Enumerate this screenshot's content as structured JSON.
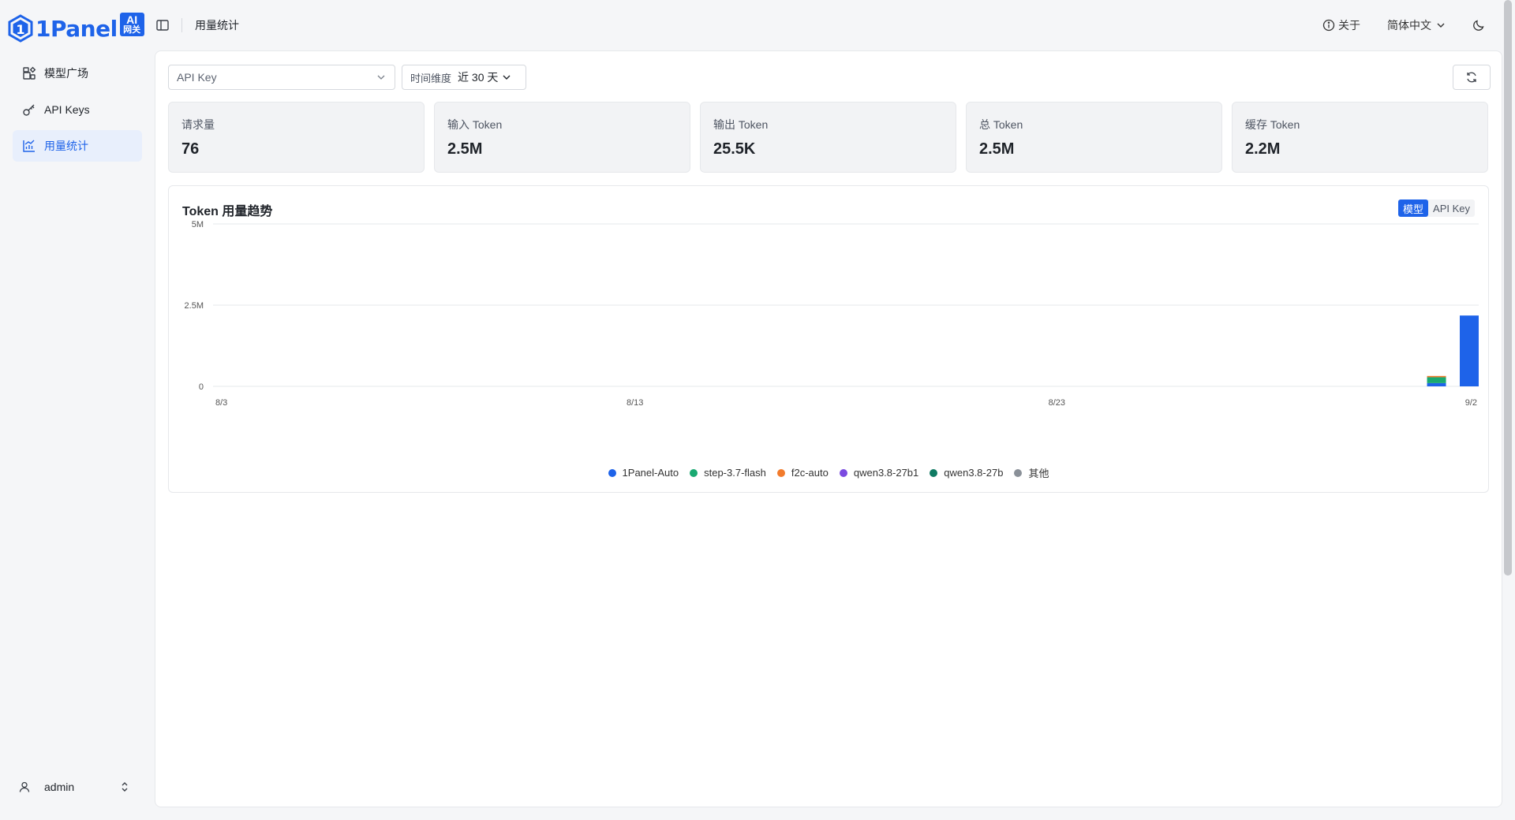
{
  "brand": {
    "name": "1Panel",
    "badge_top": "AI",
    "badge_bottom": "网关",
    "color": "#1e63e9"
  },
  "sidebar": {
    "items": [
      {
        "label": "模型广场",
        "icon": "grid-icon",
        "active": false
      },
      {
        "label": "API Keys",
        "icon": "key-icon",
        "active": false
      },
      {
        "label": "用量统计",
        "icon": "chart-icon",
        "active": true
      }
    ],
    "user": {
      "name": "admin"
    }
  },
  "topbar": {
    "breadcrumb": "用量统计",
    "about": "关于",
    "language": "简体中文"
  },
  "filters": {
    "apikey_placeholder": "API Key",
    "range_label": "时间维度",
    "range_value": "近 30 天"
  },
  "stats": [
    {
      "title": "请求量",
      "value": "76"
    },
    {
      "title": "输入 Token",
      "value": "2.5M"
    },
    {
      "title": "输出 Token",
      "value": "25.5K"
    },
    {
      "title": "总 Token",
      "value": "2.5M"
    },
    {
      "title": "缓存 Token",
      "value": "2.2M"
    }
  ],
  "chart": {
    "title": "Token 用量趋势",
    "toggle": {
      "model": "模型",
      "apikey": "API Key",
      "active": "model"
    }
  },
  "chart_data": {
    "type": "bar",
    "stacked": true,
    "title": "Token 用量趋势",
    "xlabel": "",
    "ylabel": "",
    "x_start": "8/3",
    "x_end": "9/2",
    "x_ticks": [
      "8/3",
      "8/13",
      "8/23",
      "9/2"
    ],
    "y_ticks": [
      "0",
      "2.5M",
      "5M"
    ],
    "ylim": [
      0,
      5000000
    ],
    "grid": true,
    "legend_placement": "bottom",
    "categories": [
      "8/3",
      "8/4",
      "8/5",
      "8/6",
      "8/7",
      "8/8",
      "8/9",
      "8/10",
      "8/11",
      "8/12",
      "8/13",
      "8/14",
      "8/15",
      "8/16",
      "8/17",
      "8/18",
      "8/19",
      "8/20",
      "8/21",
      "8/22",
      "8/23",
      "8/24",
      "8/25",
      "8/26",
      "8/27",
      "8/28",
      "8/29",
      "8/30",
      "8/31",
      "9/1",
      "9/2"
    ],
    "series": [
      {
        "name": "1Panel-Auto",
        "color": "#1e63e9",
        "values": [
          0,
          0,
          0,
          0,
          0,
          0,
          0,
          0,
          0,
          0,
          0,
          0,
          0,
          0,
          0,
          0,
          0,
          0,
          0,
          0,
          0,
          0,
          0,
          0,
          0,
          0,
          0,
          0,
          0,
          100000,
          2180000
        ]
      },
      {
        "name": "step-3.7-flash",
        "color": "#19a971",
        "values": [
          0,
          0,
          0,
          0,
          0,
          0,
          0,
          0,
          0,
          0,
          0,
          0,
          0,
          0,
          0,
          0,
          0,
          0,
          0,
          0,
          0,
          0,
          0,
          0,
          0,
          0,
          0,
          0,
          0,
          180000,
          0
        ]
      },
      {
        "name": "f2c-auto",
        "color": "#f27b2c",
        "values": [
          0,
          0,
          0,
          0,
          0,
          0,
          0,
          0,
          0,
          0,
          0,
          0,
          0,
          0,
          0,
          0,
          0,
          0,
          0,
          0,
          0,
          0,
          0,
          0,
          0,
          0,
          0,
          0,
          0,
          40000,
          0
        ]
      },
      {
        "name": "qwen3.8-27b1",
        "color": "#7a4ae0",
        "values": [
          0,
          0,
          0,
          0,
          0,
          0,
          0,
          0,
          0,
          0,
          0,
          0,
          0,
          0,
          0,
          0,
          0,
          0,
          0,
          0,
          0,
          0,
          0,
          0,
          0,
          0,
          0,
          0,
          0,
          0,
          0
        ]
      },
      {
        "name": "qwen3.8-27b",
        "color": "#0f7a62",
        "values": [
          0,
          0,
          0,
          0,
          0,
          0,
          0,
          0,
          0,
          0,
          0,
          0,
          0,
          0,
          0,
          0,
          0,
          0,
          0,
          0,
          0,
          0,
          0,
          0,
          0,
          0,
          0,
          0,
          0,
          0,
          0
        ]
      },
      {
        "name": "其他",
        "color": "#8a9098",
        "values": [
          0,
          0,
          0,
          0,
          0,
          0,
          0,
          0,
          0,
          0,
          0,
          0,
          0,
          0,
          0,
          0,
          0,
          0,
          0,
          0,
          0,
          0,
          0,
          0,
          0,
          0,
          0,
          0,
          0,
          0,
          0
        ]
      }
    ]
  }
}
